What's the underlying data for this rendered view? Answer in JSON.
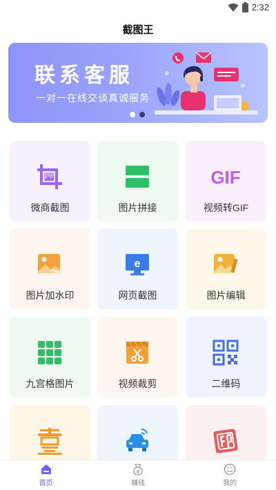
{
  "status_bar": {
    "time": "2:32",
    "icons": [
      "wifi-icon",
      "battery-icon"
    ]
  },
  "app_title": "截图王",
  "banner": {
    "title": "联系客服",
    "subtitle": "一对一在线交谈真诚服务",
    "active_slide_index": 2,
    "slide_count": 2
  },
  "tiles": [
    {
      "label": "微商截图",
      "icon": "crop-icon",
      "bg": "#f6f1fd",
      "color": "#9a66f0"
    },
    {
      "label": "图片拼接",
      "icon": "stack-icon",
      "bg": "#eefaf0",
      "color": "#2fbf66"
    },
    {
      "label": "视频转GIF",
      "icon": "gif-icon",
      "bg": "#f9f0fb",
      "color": "#c15ce6"
    },
    {
      "label": "图片加水印",
      "icon": "watermark-icon",
      "bg": "#fdf6ee",
      "color": "#f2a13a"
    },
    {
      "label": "网页截图",
      "icon": "monitor-icon",
      "bg": "#eef5fd",
      "color": "#3a7de8"
    },
    {
      "label": "图片编辑",
      "icon": "image-edit-icon",
      "bg": "#fdf8e9",
      "color": "#f4b23b"
    },
    {
      "label": "九宫格图片",
      "icon": "grid-icon",
      "bg": "#eefaf0",
      "color": "#2fbf66"
    },
    {
      "label": "视频裁剪",
      "icon": "video-cut-icon",
      "bg": "#fdf6ee",
      "color": "#f2a13a"
    },
    {
      "label": "二维码",
      "icon": "qr-icon",
      "bg": "#eef3fd",
      "color": "#4a6ed8"
    },
    {
      "label": "",
      "icon": "yi-char-icon",
      "bg": "#fdf6e6",
      "color": "#f09a2a"
    },
    {
      "label": "",
      "icon": "car-icon",
      "bg": "#eef5fd",
      "color": "#2a8fe8"
    },
    {
      "label": "",
      "icon": "stamp-icon",
      "bg": "#fdf0f0",
      "color": "#e65a5a"
    }
  ],
  "bottom_nav": [
    {
      "label": "首页",
      "icon": "home-icon",
      "active": true
    },
    {
      "label": "赚钱",
      "icon": "money-icon",
      "active": false
    },
    {
      "label": "我的",
      "icon": "profile-icon",
      "active": false
    }
  ],
  "colors": {
    "accent": "#7b5cf5",
    "banner_start": "#8e94f7",
    "banner_end": "#b8c4ff"
  }
}
